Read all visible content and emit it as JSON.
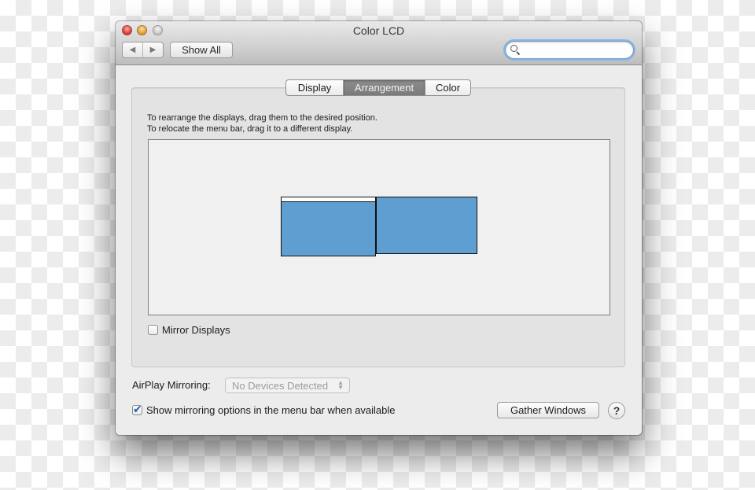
{
  "window": {
    "title": "Color LCD"
  },
  "toolbar": {
    "back_icon": "◀",
    "forward_icon": "▶",
    "show_all_label": "Show All",
    "search": {
      "value": "",
      "placeholder": ""
    }
  },
  "tabs": [
    {
      "label": "Display",
      "active": false
    },
    {
      "label": "Arrangement",
      "active": true
    },
    {
      "label": "Color",
      "active": false
    }
  ],
  "arrangement": {
    "instructions_line1": "To rearrange the displays, drag them to the desired position.",
    "instructions_line2": "To relocate the menu bar, drag it to a different display.",
    "display_color": "#5e9ed1",
    "displays": [
      {
        "name": "main display",
        "has_menu_bar": true
      },
      {
        "name": "secondary display",
        "has_menu_bar": false
      }
    ]
  },
  "mirror_displays": {
    "label": "Mirror Displays",
    "checked": false
  },
  "airplay": {
    "label": "AirPlay Mirroring:",
    "selected": "No Devices Detected",
    "enabled": false
  },
  "show_mirroring_options": {
    "label": "Show mirroring options in the menu bar when available",
    "checked": true
  },
  "buttons": {
    "gather_windows": "Gather Windows",
    "help": "?"
  }
}
